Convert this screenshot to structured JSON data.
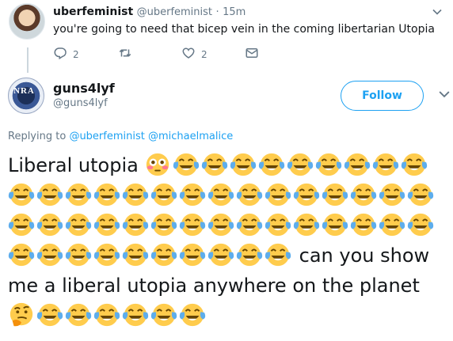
{
  "parent_tweet": {
    "name": "uberfeminist",
    "handle": "@uberfeminist",
    "separator": "·",
    "time": "15m",
    "text": "you're going to need that bicep vein in the coming libertarian Utopia",
    "reply_count": "2",
    "like_count": "2"
  },
  "main_tweet": {
    "name": "guns4lyf",
    "handle": "@guns4lyf",
    "follow_label": "Follow",
    "avatar_text": "NRA",
    "replying_prefix": "Replying to",
    "replying_mentions": [
      "@uberfeminist",
      "@michaelmalice"
    ],
    "text_part1": "Liberal utopia",
    "text_part2": "can you show me a liberal utopia",
    "text_part3": "anywhere on the planet",
    "emoji_sequence": [
      "flushed-face",
      "joy x49",
      "thinking-face",
      "joy x6"
    ]
  },
  "colors": {
    "accent": "#1da1f2",
    "muted": "#657786",
    "text": "#14171a",
    "emoji_yellow": "#ffcc4d"
  }
}
